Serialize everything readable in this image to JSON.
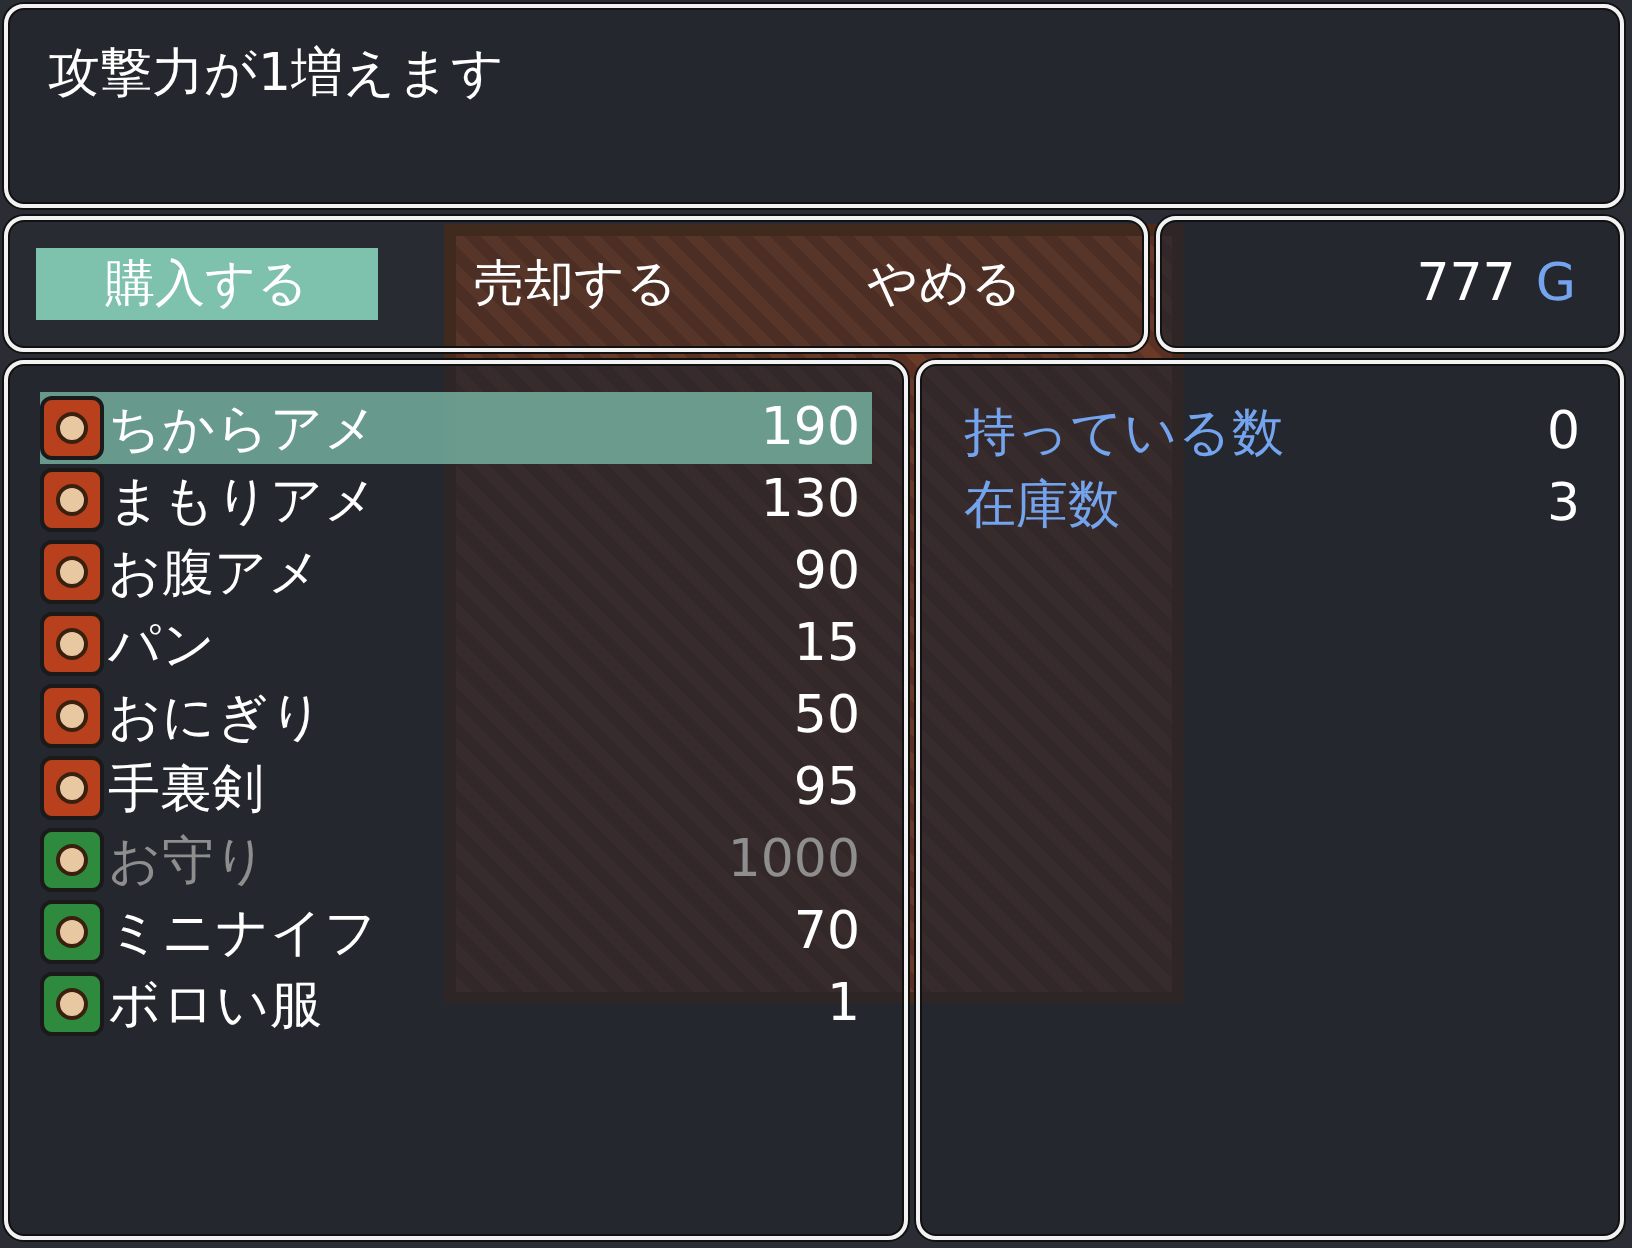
{
  "help_window": {
    "text": "攻撃力が1増えます"
  },
  "commands": [
    {
      "label": "購入する",
      "selected": true
    },
    {
      "label": "売却する",
      "selected": false
    },
    {
      "label": "やめる",
      "selected": false
    }
  ],
  "gold": {
    "amount": "777",
    "unit": "G"
  },
  "items": [
    {
      "name": "ちからアメ",
      "price": "190",
      "selected": true,
      "disabled": false,
      "color": "#b8401c"
    },
    {
      "name": "まもりアメ",
      "price": "130",
      "selected": false,
      "disabled": false,
      "color": "#b8401c"
    },
    {
      "name": "お腹アメ",
      "price": "90",
      "selected": false,
      "disabled": false,
      "color": "#b8401c"
    },
    {
      "name": "パン",
      "price": "15",
      "selected": false,
      "disabled": false,
      "color": "#b8401c"
    },
    {
      "name": "おにぎり",
      "price": "50",
      "selected": false,
      "disabled": false,
      "color": "#b8401c"
    },
    {
      "name": "手裏剣",
      "price": "95",
      "selected": false,
      "disabled": false,
      "color": "#b8401c"
    },
    {
      "name": "お守り",
      "price": "1000",
      "selected": false,
      "disabled": true,
      "color": "#2e8a3c"
    },
    {
      "name": "ミニナイフ",
      "price": "70",
      "selected": false,
      "disabled": false,
      "color": "#2e8a3c"
    },
    {
      "name": "ボロい服",
      "price": "1",
      "selected": false,
      "disabled": false,
      "color": "#2e8a3c"
    }
  ],
  "status": [
    {
      "label": "持っている数",
      "value": "0"
    },
    {
      "label": "在庫数",
      "value": "3"
    }
  ]
}
